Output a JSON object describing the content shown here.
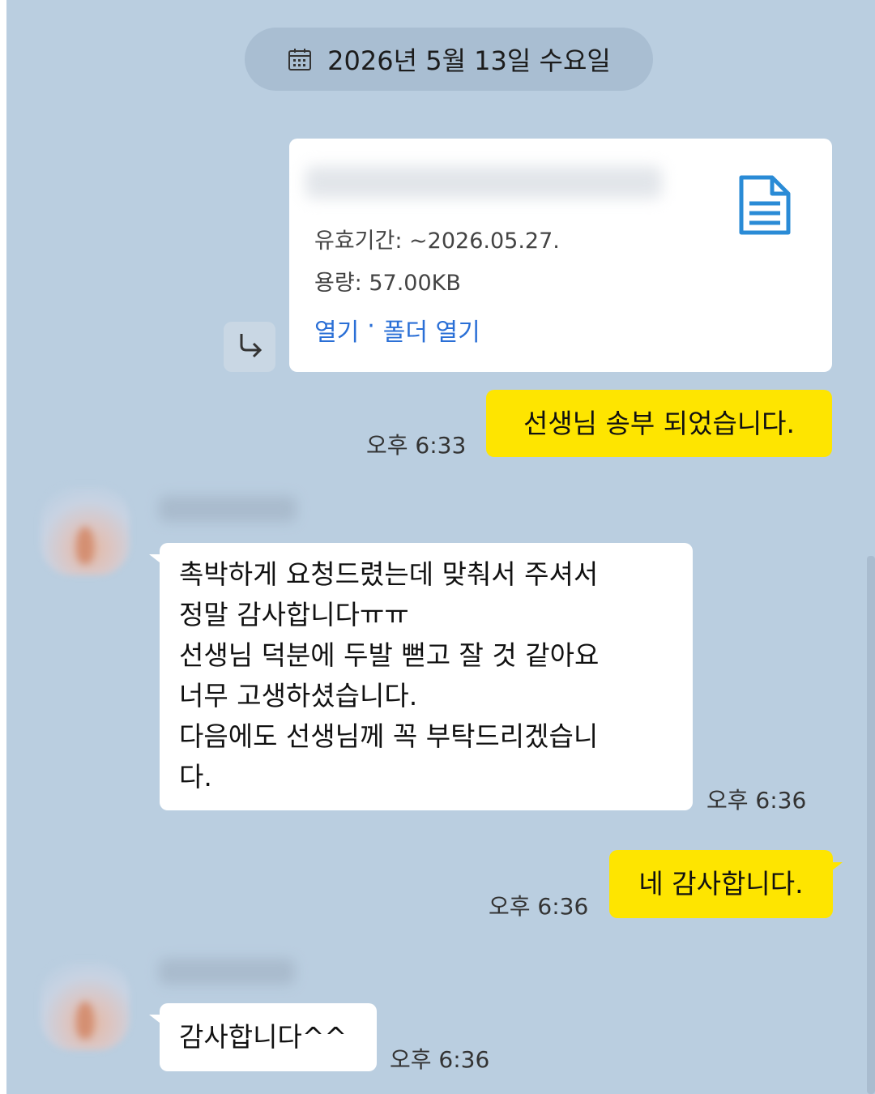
{
  "date_divider": {
    "label": "2026년 5월 13일 수요일"
  },
  "file_message": {
    "file_name": "",
    "expiry": "유효기간: ~2026.05.27.",
    "size": "용량: 57.00KB",
    "open_label": "열기",
    "separator": "·",
    "open_folder_label": "폴더 열기",
    "icon": "document-icon"
  },
  "messages": [
    {
      "from": "me",
      "text": "선생님 송부 되었습니다.",
      "time": "오후 6:33"
    },
    {
      "from": "other",
      "sender": "",
      "text": "촉박하게 요청드렸는데 맞춰서 주셔서\n정말 감사합니다ㅠㅠ\n선생님 덕분에 두발 뻗고 잘 것 같아요\n너무 고생하셨습니다.\n다음에도 선생님께 꼭 부탁드리겠습니\n다.",
      "time": "오후 6:36"
    },
    {
      "from": "me",
      "text": "네 감사합니다.",
      "time": "오후 6:36"
    },
    {
      "from": "other",
      "sender": "",
      "text": "감사합니다^^",
      "time": "오후 6:36"
    }
  ],
  "colors": {
    "background": "#bacee0",
    "my_bubble": "#fee500",
    "other_bubble": "#ffffff",
    "link": "#2a6fd6"
  }
}
